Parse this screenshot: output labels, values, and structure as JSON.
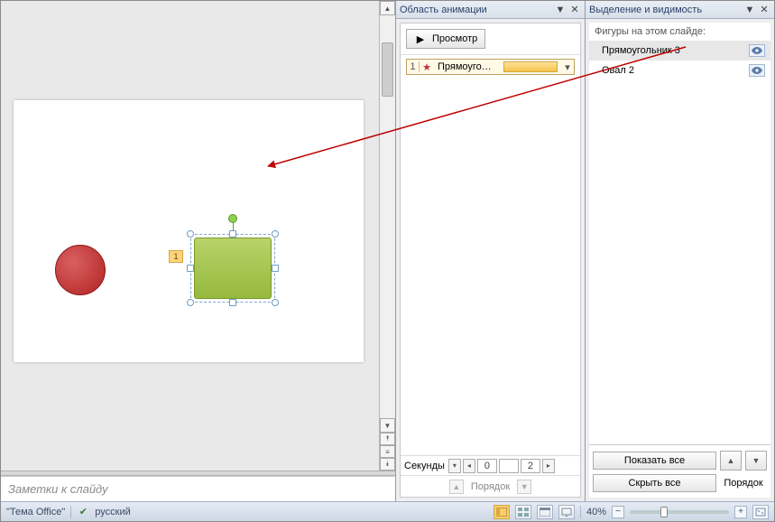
{
  "panes": {
    "animation": {
      "title": "Область анимации"
    },
    "selection": {
      "title": "Выделение и видимость",
      "caption": "Фигуры на этом слайде:"
    }
  },
  "animation": {
    "preview_label": "Просмотр",
    "items": [
      {
        "index": "1",
        "label": "Прямоугольн..."
      }
    ],
    "timeline": {
      "label": "Секунды",
      "cells": [
        "0",
        "",
        "2"
      ]
    },
    "order_label": "Порядок"
  },
  "selection": {
    "items": [
      {
        "name": "Прямоугольник 3",
        "selected": true
      },
      {
        "name": "Овал 2",
        "selected": false
      }
    ],
    "show_all": "Показать все",
    "hide_all": "Скрыть все",
    "order_label": "Порядок"
  },
  "slide": {
    "notes_placeholder": "Заметки к слайду",
    "anim_tag": "1"
  },
  "status": {
    "theme": "\"Тема Office\"",
    "lang": "русский",
    "zoom": "40%"
  }
}
